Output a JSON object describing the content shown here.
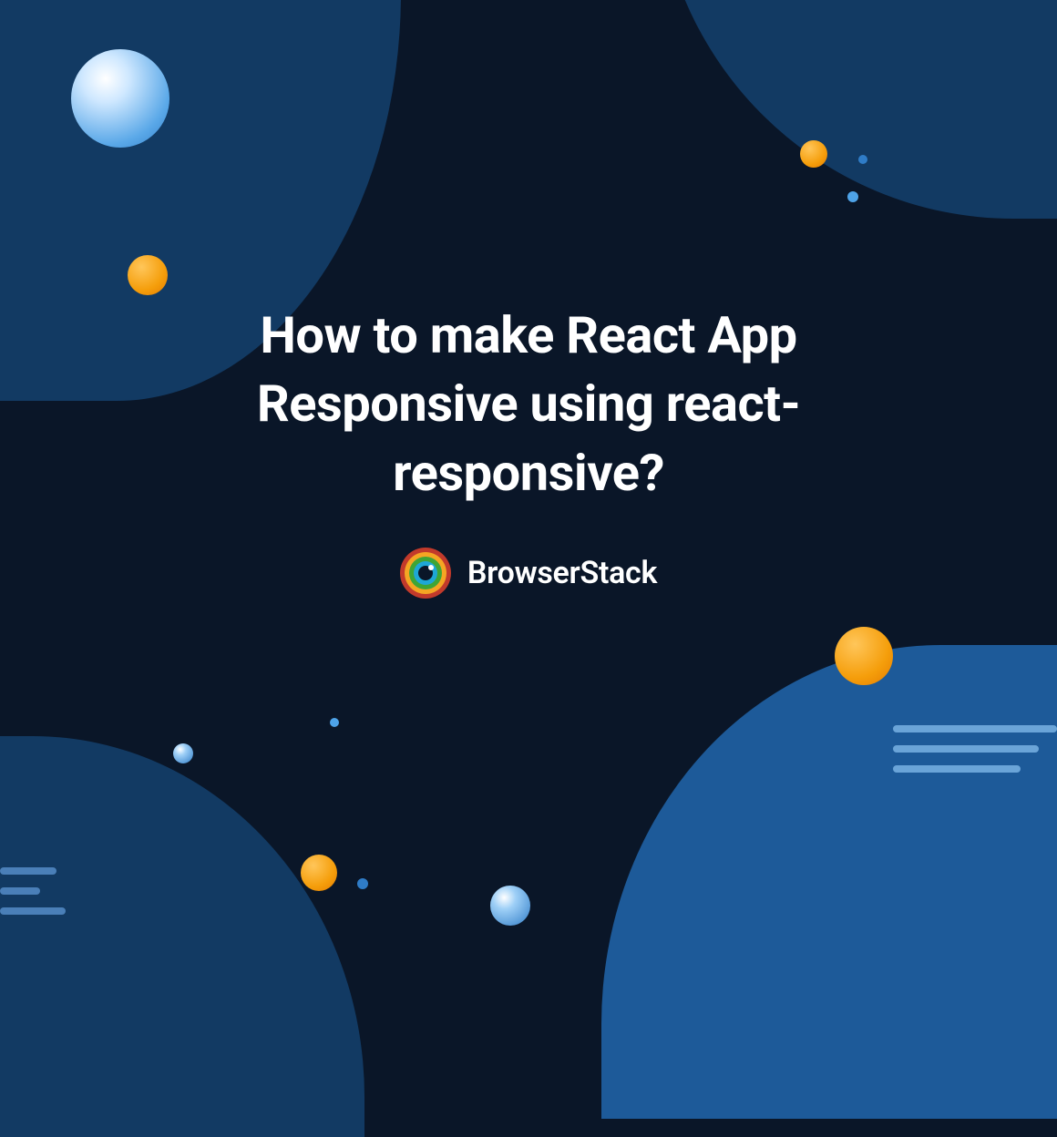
{
  "title": "How to make React App Responsive using react-responsive?",
  "brand": {
    "name": "BrowserStack"
  },
  "colors": {
    "bg": "#0a1628",
    "blob_dark": "#123a63",
    "blob_light": "#1d5a99",
    "orange": "#f59e0b",
    "blue": "#2f7cc7"
  }
}
